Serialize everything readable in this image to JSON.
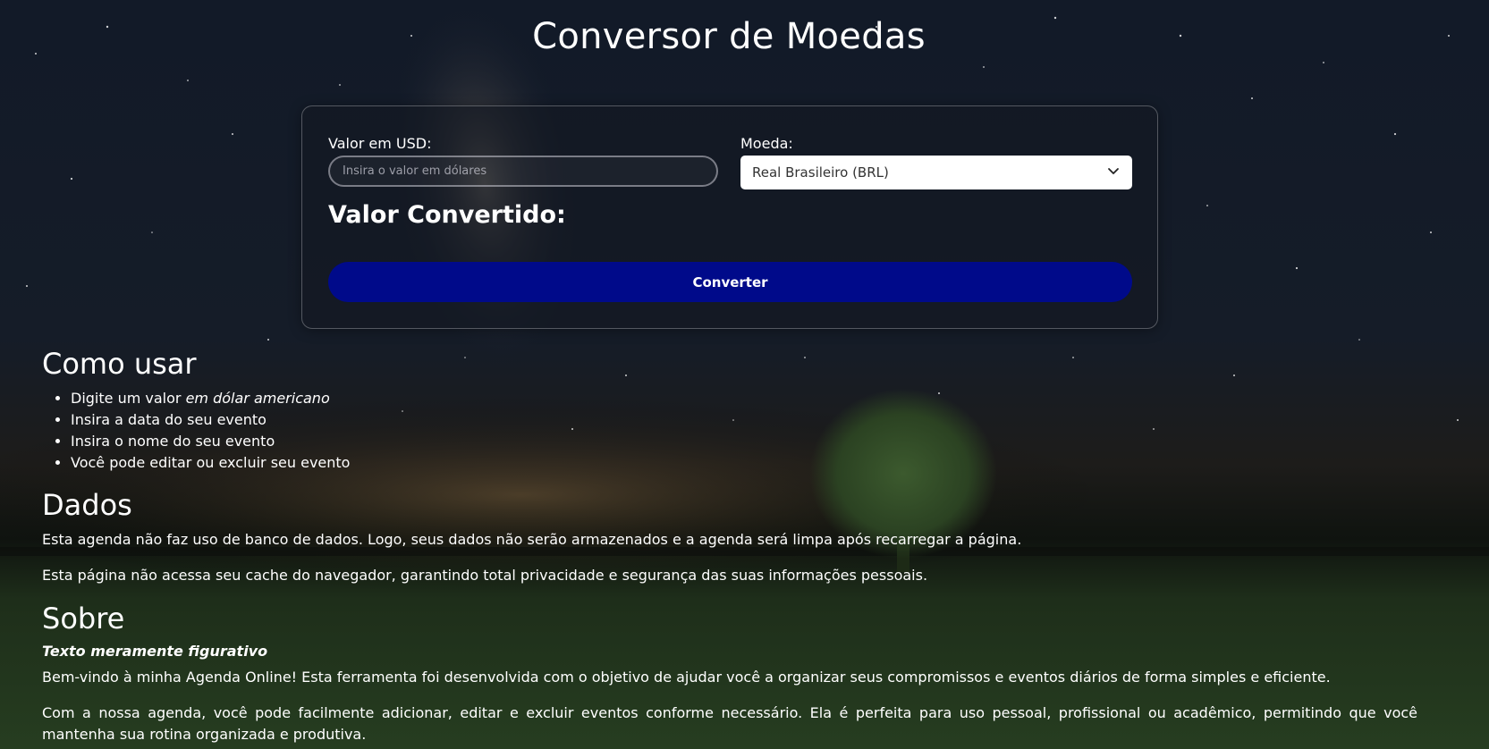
{
  "title": "Conversor de Moedas",
  "converter": {
    "usd_label": "Valor em USD:",
    "usd_placeholder": "Insira o valor em dólares",
    "currency_label": "Moeda:",
    "currency_selected": "Real Brasileiro (BRL)",
    "converted_label": "Valor Convertido:",
    "convert_button": "Converter"
  },
  "como_usar": {
    "heading": "Como usar",
    "items": [
      {
        "prefix": "Digite um valor ",
        "emphasis": "em dólar americano"
      },
      {
        "prefix": "Insira a data do seu evento",
        "emphasis": ""
      },
      {
        "prefix": "Insira o nome do seu evento",
        "emphasis": ""
      },
      {
        "prefix": "Você pode editar ou excluir seu evento",
        "emphasis": ""
      }
    ]
  },
  "dados": {
    "heading": "Dados",
    "p1": "Esta agenda não faz uso de banco de dados. Logo, seus dados não serão armazenados e a agenda será limpa após recarregar a página.",
    "p2": "Esta página não acessa seu cache do navegador, garantindo total privacidade e segurança das suas informações pessoais."
  },
  "sobre": {
    "heading": "Sobre",
    "subtitle": "Texto meramente figurativo",
    "p1": "Bem-vindo à minha Agenda Online! Esta ferramenta foi desenvolvida com o objetivo de ajudar você a organizar seus compromissos e eventos diários de forma simples e eficiente.",
    "p2": "Com a nossa agenda, você pode facilmente adicionar, editar e excluir eventos conforme necessário. Ela é perfeita para uso pessoal, profissional ou acadêmico, permitindo que você mantenha sua rotina organizada e produtiva."
  },
  "colors": {
    "button": "#000a8a",
    "card_bg": "rgba(20,24,34,0.62)"
  },
  "icons": {
    "select": "chevron-down-icon"
  }
}
